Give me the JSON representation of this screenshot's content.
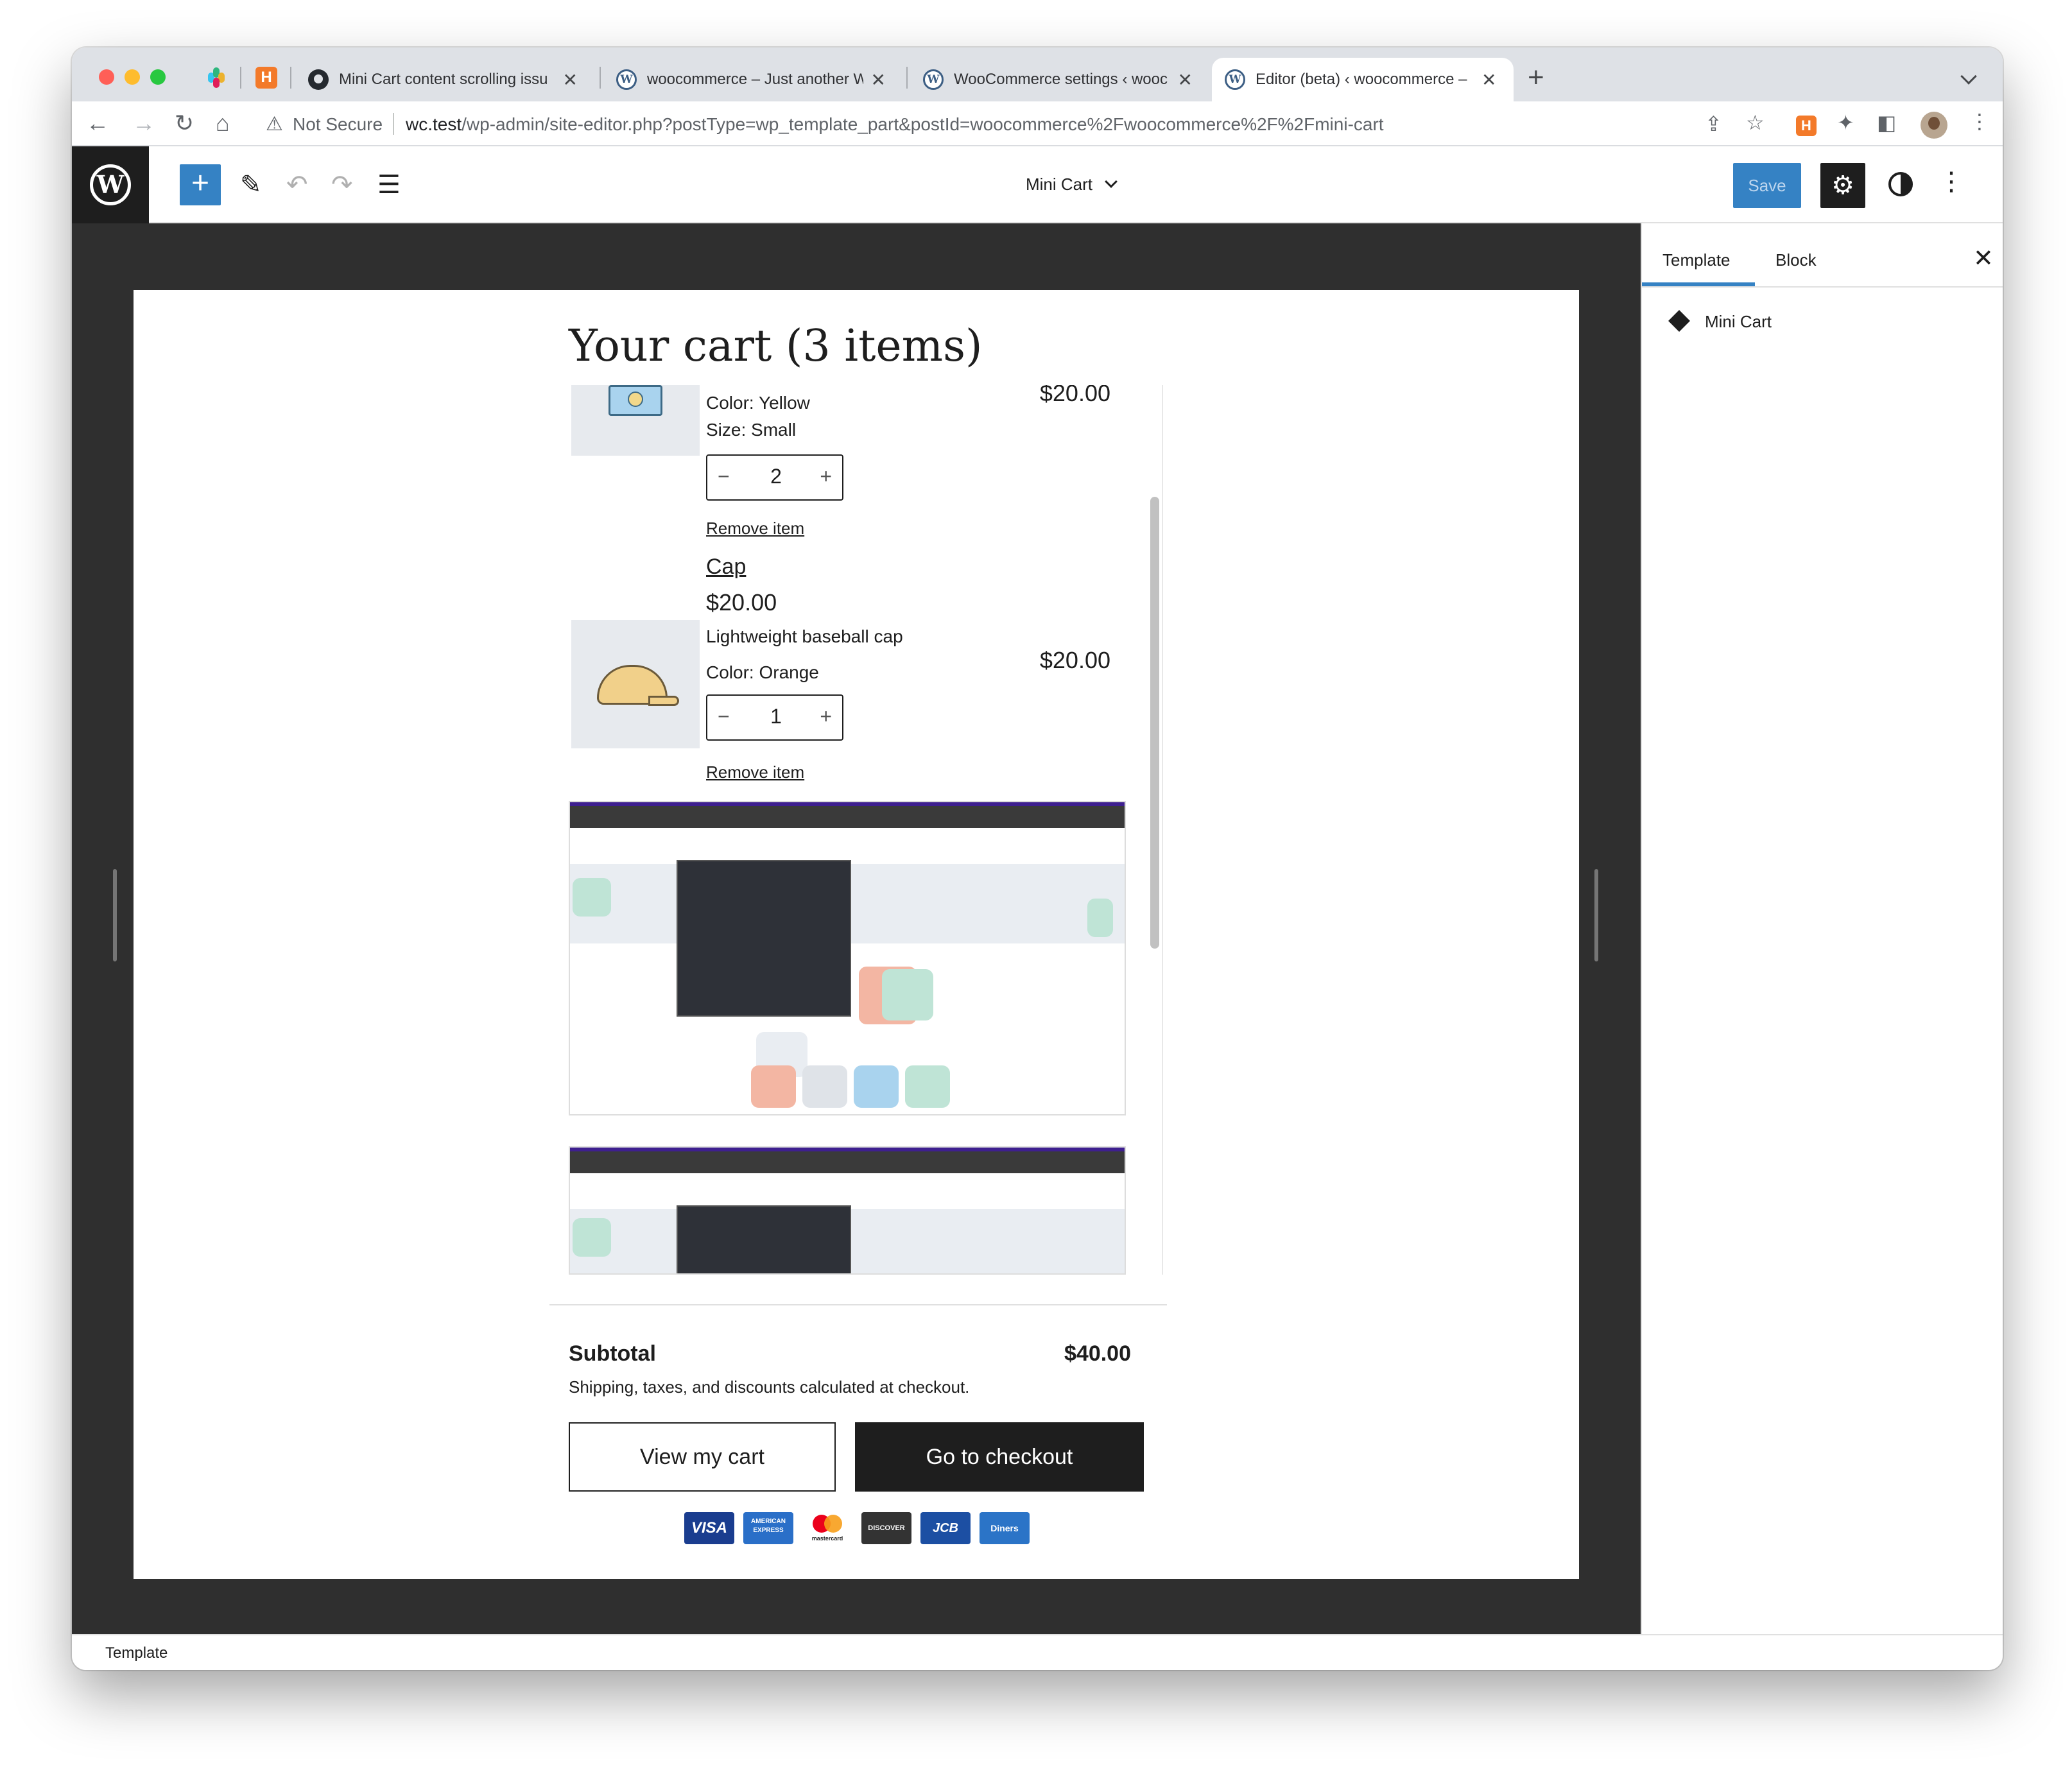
{
  "browser": {
    "tabs": [
      {
        "label": "Mini Cart content scrolling issu",
        "icon": "github-icon"
      },
      {
        "label": "woocommerce – Just another W",
        "icon": "wordpress-icon"
      },
      {
        "label": "WooCommerce settings ‹ wooc",
        "icon": "wordpress-icon"
      },
      {
        "label": "Editor (beta) ‹ woocommerce –",
        "icon": "wordpress-icon",
        "active": true
      }
    ],
    "new_tab": "+",
    "security": "Not Secure",
    "url_host": "wc.test",
    "url_path": "/wp-admin/site-editor.php?postType=wp_template_part&postId=woocommerce%2Fwoocommerce%2F%2Fmini-cart",
    "ext_label": "H"
  },
  "editor": {
    "logo": "W",
    "add_symbol": "+",
    "document_title": "Mini Cart",
    "save_label": "Save",
    "accent": "#3582c4"
  },
  "mini_cart": {
    "title": "Your cart (3 items)",
    "items": [
      {
        "attributes": [
          "Color: Yellow",
          "Size: Small"
        ],
        "quantity": "2",
        "line_total": "$20.00",
        "remove_label": "Remove item"
      },
      {
        "name": "Cap",
        "price": "$20.00",
        "description": "Lightweight baseball cap",
        "attributes": [
          "Color: Orange"
        ],
        "quantity": "1",
        "line_total": "$20.00",
        "remove_label": "Remove item"
      }
    ],
    "qty_minus": "−",
    "qty_plus": "+",
    "subtotal_label": "Subtotal",
    "subtotal_value": "$40.00",
    "shipping_note": "Shipping, taxes, and discounts calculated at checkout.",
    "view_cart_label": "View my cart",
    "checkout_label": "Go to checkout",
    "payment_cards": [
      "VISA",
      "AMERICAN EXPRESS",
      "mastercard",
      "DISCOVER",
      "JCB",
      "Diners"
    ]
  },
  "sidebar": {
    "tab_template": "Template",
    "tab_block": "Block",
    "block_name": "Mini Cart"
  },
  "statusbar": {
    "breadcrumb": "Template"
  }
}
